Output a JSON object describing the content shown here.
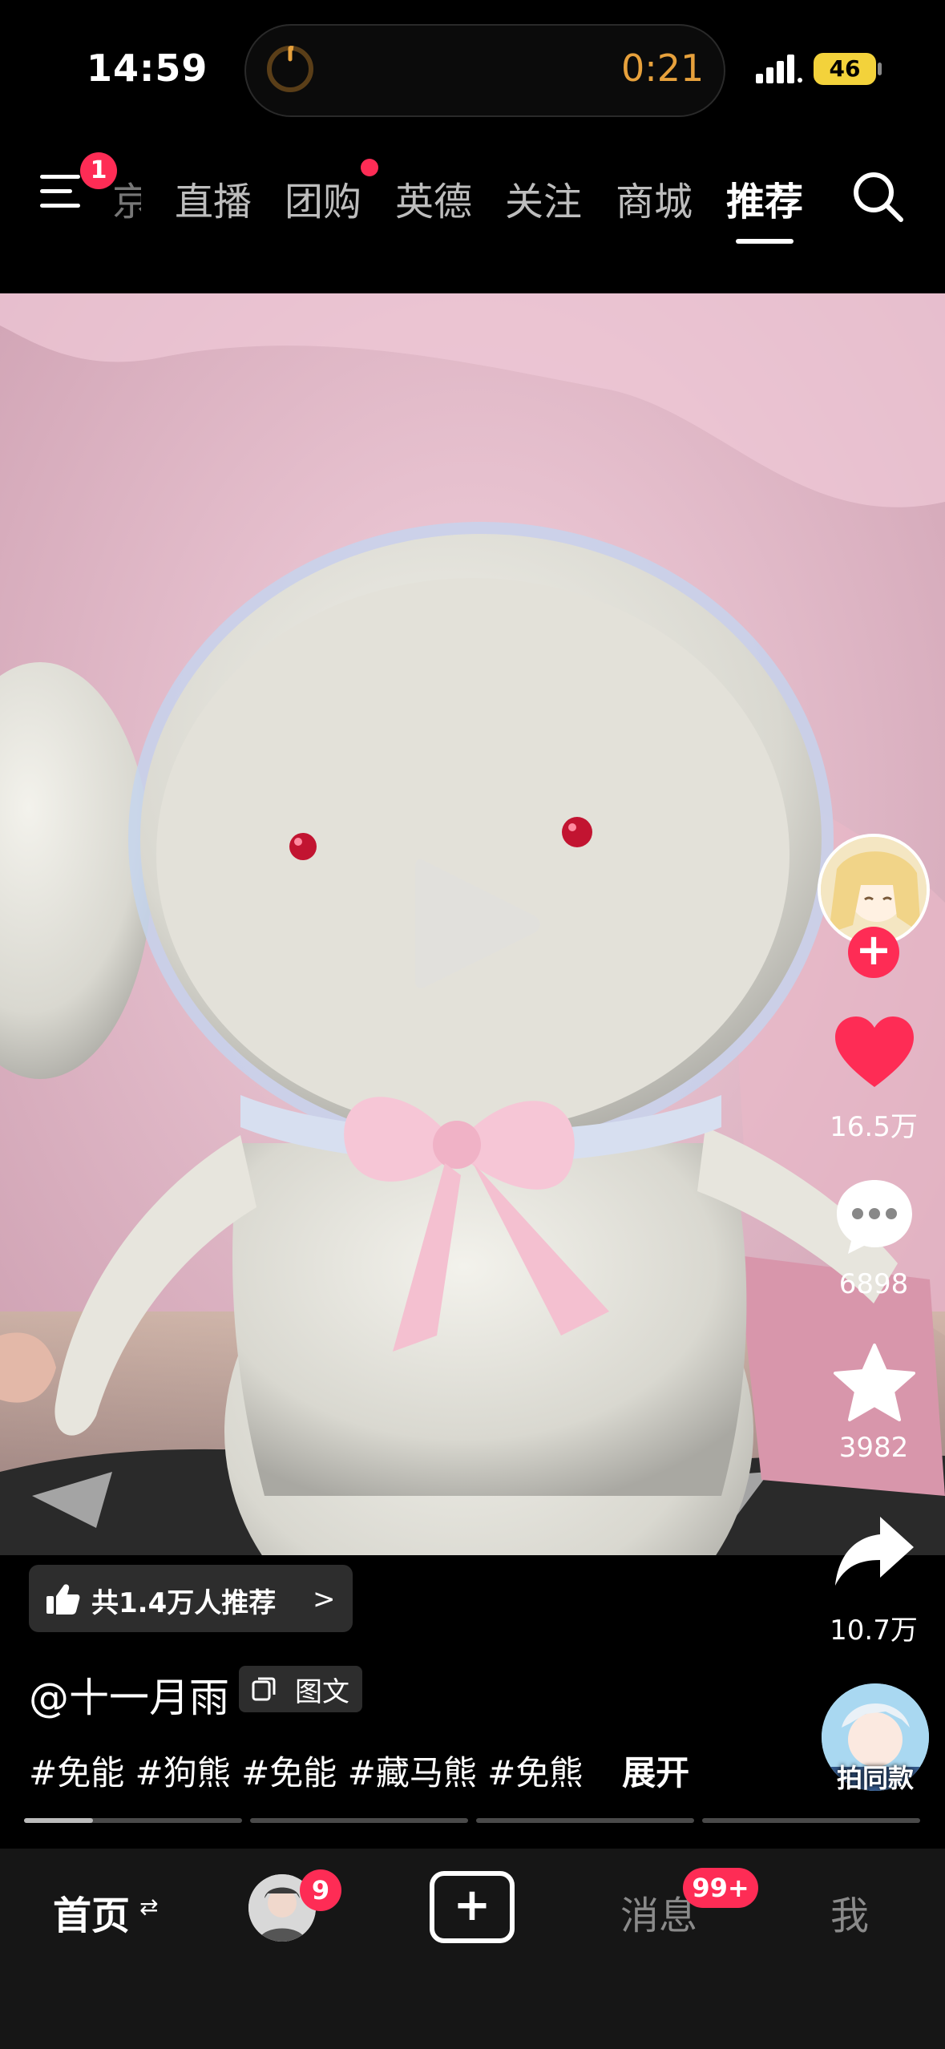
{
  "status_bar": {
    "time": "14:59",
    "timer": "0:21",
    "battery": "46"
  },
  "top_nav": {
    "menu_badge": "1",
    "partial_tab": "京",
    "tabs": [
      "直播",
      "团购",
      "英德",
      "关注",
      "商城",
      "推荐"
    ],
    "active_tab": "推荐"
  },
  "right_rail": {
    "like_count": "16.5万",
    "comment_count": "6898",
    "favorite_count": "3982",
    "share_count": "10.7万",
    "same_style_label": "拍同款"
  },
  "post": {
    "recommend_text": "共1.4万人推荐",
    "author": "@十一月雨",
    "type_label": "图文",
    "hashtags": "#免能 #狗熊 #免能 #藏马熊 #免熊",
    "expand_label": "展开",
    "progress_segments": 4
  },
  "bottom_nav": {
    "home": "首页",
    "friend_badge": "9",
    "messages": "消息",
    "messages_badge": "99+",
    "me": "我"
  },
  "colors": {
    "accent": "#fe2c55",
    "timer": "#e7a13c",
    "battery": "#f3d23b",
    "background": "#000000"
  }
}
